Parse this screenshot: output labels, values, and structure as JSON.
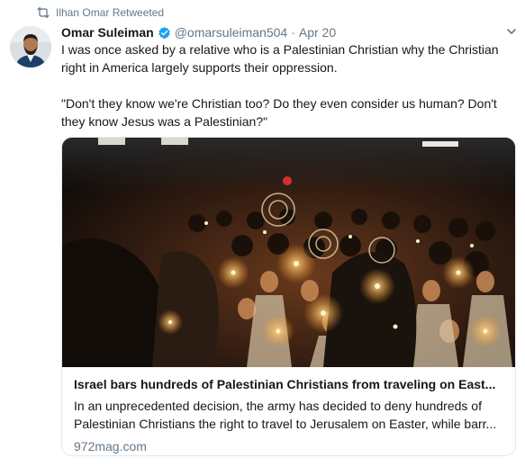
{
  "retweet": {
    "text": "Ilhan Omar Retweeted",
    "icon": "retweet-icon"
  },
  "author": {
    "name": "Omar Suleiman",
    "handle": "@omarsuleiman504",
    "separator": "·",
    "date": "Apr 20",
    "verified_icon": "verified-badge-icon",
    "avatar": "author-avatar"
  },
  "tweet": {
    "paragraphs": [
      "I was once asked by a relative who is a Palestinian Christian why the Christian right in America largely supports their oppression.",
      "\"Don't they know we're Christian too? Do they even consider us human? Don't they know Jesus was a Palestinian?\""
    ]
  },
  "card": {
    "image": "candlelight-easter-procession-photo",
    "title": "Israel bars hundreds of Palestinian Christians from traveling on East...",
    "description": "In an unprecedented decision, the army has decided to deny hundreds of Palestinian Christians the right to travel to Jerusalem on Easter, while barr...",
    "domain": "972mag.com"
  },
  "colors": {
    "text": "#14171a",
    "secondary": "#657786",
    "verified_blue": "#1da1f2",
    "border": "#e1e8ed"
  }
}
